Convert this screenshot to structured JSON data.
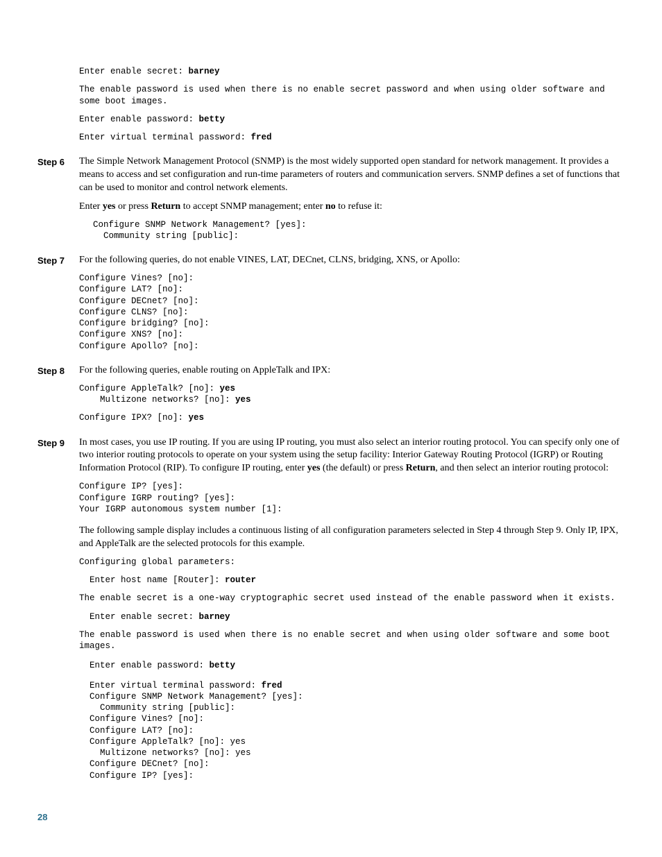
{
  "intro": {
    "code1_line": "Enter enable secret: ",
    "code1_bold": "barney",
    "para1": "The enable password is used when there is no enable secret password and when using older software and some boot images.",
    "code2_line": "Enter enable password: ",
    "code2_bold": "betty",
    "code3_line": "Enter virtual terminal password: ",
    "code3_bold": "fred"
  },
  "step6": {
    "label": "Step 6",
    "p1": "The Simple Network Management Protocol (SNMP) is the most widely supported open standard for network management. It provides a means to access and set configuration and run-time parameters of routers and communication servers. SNMP defines a set of functions that can be used to monitor and control network elements.",
    "p2_a": "Enter ",
    "p2_b": "yes",
    "p2_c": " or press ",
    "p2_d": "Return",
    "p2_e": " to accept SNMP management; enter ",
    "p2_f": "no",
    "p2_g": " to refuse it:",
    "code": "Configure SNMP Network Management? [yes]:\n  Community string [public]:"
  },
  "step7": {
    "label": "Step 7",
    "p1": "For the following queries, do not enable VINES, LAT, DECnet, CLNS, bridging, XNS, or Apollo:",
    "code": "Configure Vines? [no]:\nConfigure LAT? [no]:\nConfigure DECnet? [no]:\nConfigure CLNS? [no]:\nConfigure bridging? [no]:\nConfigure XNS? [no]:\nConfigure Apollo? [no]:"
  },
  "step8": {
    "label": "Step 8",
    "p1": "For the following queries, enable routing on AppleTalk and IPX:",
    "code1_l1": "Configure AppleTalk? [no]: ",
    "code1_l1b": "yes",
    "code1_l2": "    Multizone networks? [no]: ",
    "code1_l2b": "yes",
    "code2_l1": "Configure IPX? [no]: ",
    "code2_l1b": "yes"
  },
  "step9": {
    "label": "Step 9",
    "p1_a": "In most cases, you use IP routing. If you are using IP routing, you must also select an interior routing protocol. You can specify only one of two interior routing protocols to operate on your system using the setup facility: Interior Gateway Routing Protocol (IGRP) or Routing Information Protocol (RIP). To configure IP routing, enter ",
    "p1_b": "yes",
    "p1_c": " (the default) or press ",
    "p1_d": "Return",
    "p1_e": ", and then select an interior routing protocol:",
    "code1": "Configure IP? [yes]:\nConfigure IGRP routing? [yes]:\nYour IGRP autonomous system number [1]:",
    "p2": "The following sample display includes a continuous listing of all configuration parameters selected in Step 4 through Step 9. Only IP, IPX, and AppleTalk are the selected protocols for this example.",
    "code2": "Configuring global parameters:",
    "code3_a": "  Enter host name [Router]: ",
    "code3_b": "router",
    "code4": "The enable secret is a one-way cryptographic secret used instead of the enable password when it exists.",
    "code5_a": "  Enter enable secret: ",
    "code5_b": "barney",
    "code6": "The enable password is used when there is no enable secret and when using older software and some boot images.",
    "code7_a": "  Enter enable password: ",
    "code7_b": "betty",
    "code8_a": "  Enter virtual terminal password: ",
    "code8_b": "fred",
    "code9": "  Configure SNMP Network Management? [yes]:\n    Community string [public]:\n  Configure Vines? [no]:\n  Configure LAT? [no]:\n  Configure AppleTalk? [no]: yes\n    Multizone networks? [no]: yes\n  Configure DECnet? [no]:\n  Configure IP? [yes]:"
  },
  "pagenum": "28"
}
